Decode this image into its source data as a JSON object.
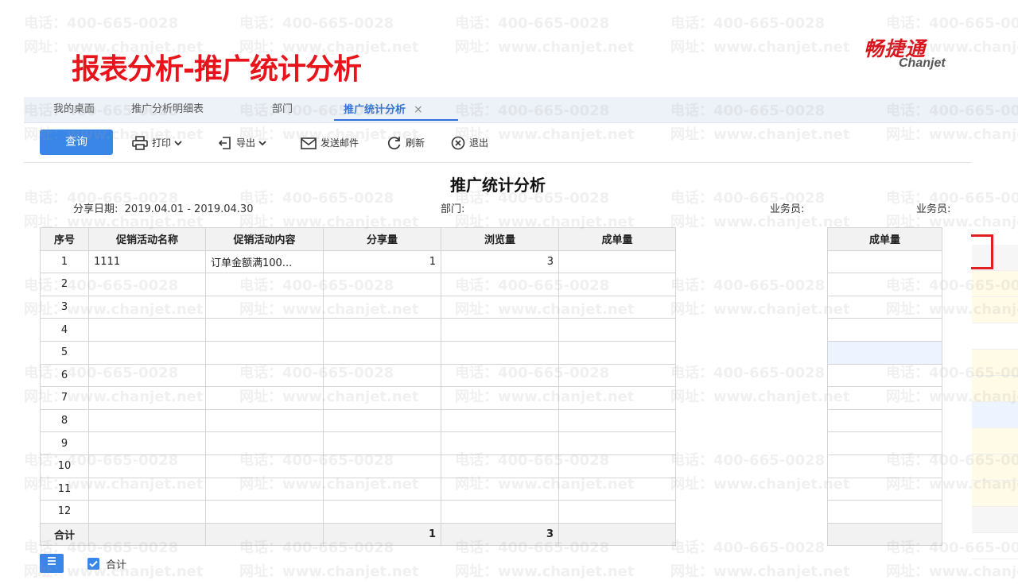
{
  "slide": {
    "title": "报表分析-推广统计分析"
  },
  "logo": {
    "cn": "畅捷通",
    "en": "Chanjet"
  },
  "watermark": {
    "phone": "电话：400-665-0028",
    "site": "网址：www.chanjet.net"
  },
  "tabs": [
    {
      "label": "我的桌面"
    },
    {
      "label": "推广分析明细表"
    },
    {
      "label": "部门"
    },
    {
      "label": "推广统计分析",
      "active": true,
      "close": "×"
    }
  ],
  "toolbar": {
    "query": "查询",
    "print": "打印",
    "export": "导出",
    "email": "发送邮件",
    "refresh": "刷新",
    "exit": "退出"
  },
  "report": {
    "title": "推广统计分析",
    "share_date_label": "分享日期:",
    "share_date_value": "2019.04.01 - 2019.04.30",
    "dept_label": "部门:",
    "salesman_label": "业务员:",
    "salesman_label2": "业务员:",
    "side_header": "成单量",
    "columns": [
      "序号",
      "促销活动名称",
      "促销活动内容",
      "分享量",
      "浏览量",
      "成单量"
    ],
    "rows": [
      [
        "1",
        "1111",
        "订单金额满100...",
        "1",
        "3",
        ""
      ],
      [
        "2",
        "",
        "",
        "",
        "",
        ""
      ],
      [
        "3",
        "",
        "",
        "",
        "",
        ""
      ],
      [
        "4",
        "",
        "",
        "",
        "",
        ""
      ],
      [
        "5",
        "",
        "",
        "",
        "",
        ""
      ],
      [
        "6",
        "",
        "",
        "",
        "",
        ""
      ],
      [
        "7",
        "",
        "",
        "",
        "",
        ""
      ],
      [
        "8",
        "",
        "",
        "",
        "",
        ""
      ],
      [
        "9",
        "",
        "",
        "",
        "",
        ""
      ],
      [
        "10",
        "",
        "",
        "",
        "",
        ""
      ],
      [
        "11",
        "",
        "",
        "",
        "",
        ""
      ],
      [
        "12",
        "",
        "",
        "",
        "",
        ""
      ]
    ],
    "total": {
      "label": "合计",
      "share": "1",
      "view": "3"
    }
  },
  "footer": {
    "checkbox_label": "合计"
  },
  "colors": {
    "accent": "#3a86e8",
    "title_red": "#e8141c"
  }
}
